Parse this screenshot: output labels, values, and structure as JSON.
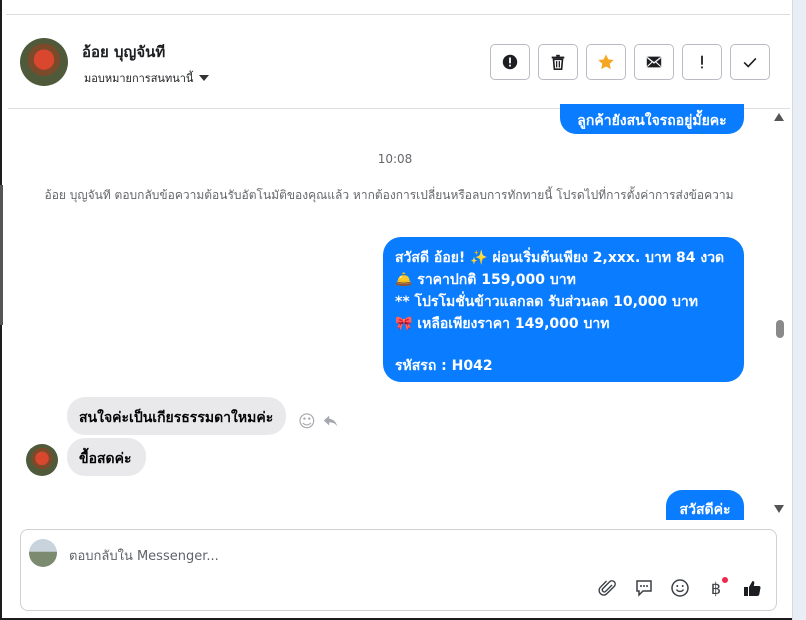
{
  "header": {
    "contact_name": "อ้อย บุญจันที",
    "assign_label": "มอบหมายการสนทนานี้",
    "actions": [
      "spam-icon",
      "trash-icon",
      "star-icon",
      "mail-icon",
      "important-icon",
      "done-icon"
    ]
  },
  "messages": {
    "outgoing_1": "ลูกค้ายังสนใจรถอยู่มั้ยคะ",
    "time": "10:08",
    "system_note": "อ้อย บุญจันที ตอบกลับข้อความต้อนรับอัตโนมัติของคุณแล้ว หากต้องการเปลี่ยนหรือลบการทักทายนี้ โปรดไปที่การตั้งค่าการส่งข้อความ",
    "outgoing_2_lines": [
      "สวัสดี อ้อย! ✨  ผ่อนเริ่มต้นเพียง 2,xxx. บาท 84 งวด",
      "🛎️ ราคาปกติ  159,000 บาท",
      "** โปรโมชั่นข้าวแลกลด รับส่วนลด 10,000 บาท",
      "🎀  เหลือเพียงราคา 149,000 บาท",
      "",
      " รหัสรถ : H042"
    ],
    "incoming_1": "สนใจค่ะเป็นเกียรธรรมดาใหมค่ะ",
    "incoming_2": "ขื้อสดค่ะ",
    "outgoing_3": "สวัสดีค่ะ"
  },
  "composer": {
    "placeholder": "ตอบกลับใน Messenger..."
  },
  "colors": {
    "outgoing_bubble": "#0a7cff",
    "incoming_bubble": "#e9e9ec",
    "star": "#f5a623"
  }
}
